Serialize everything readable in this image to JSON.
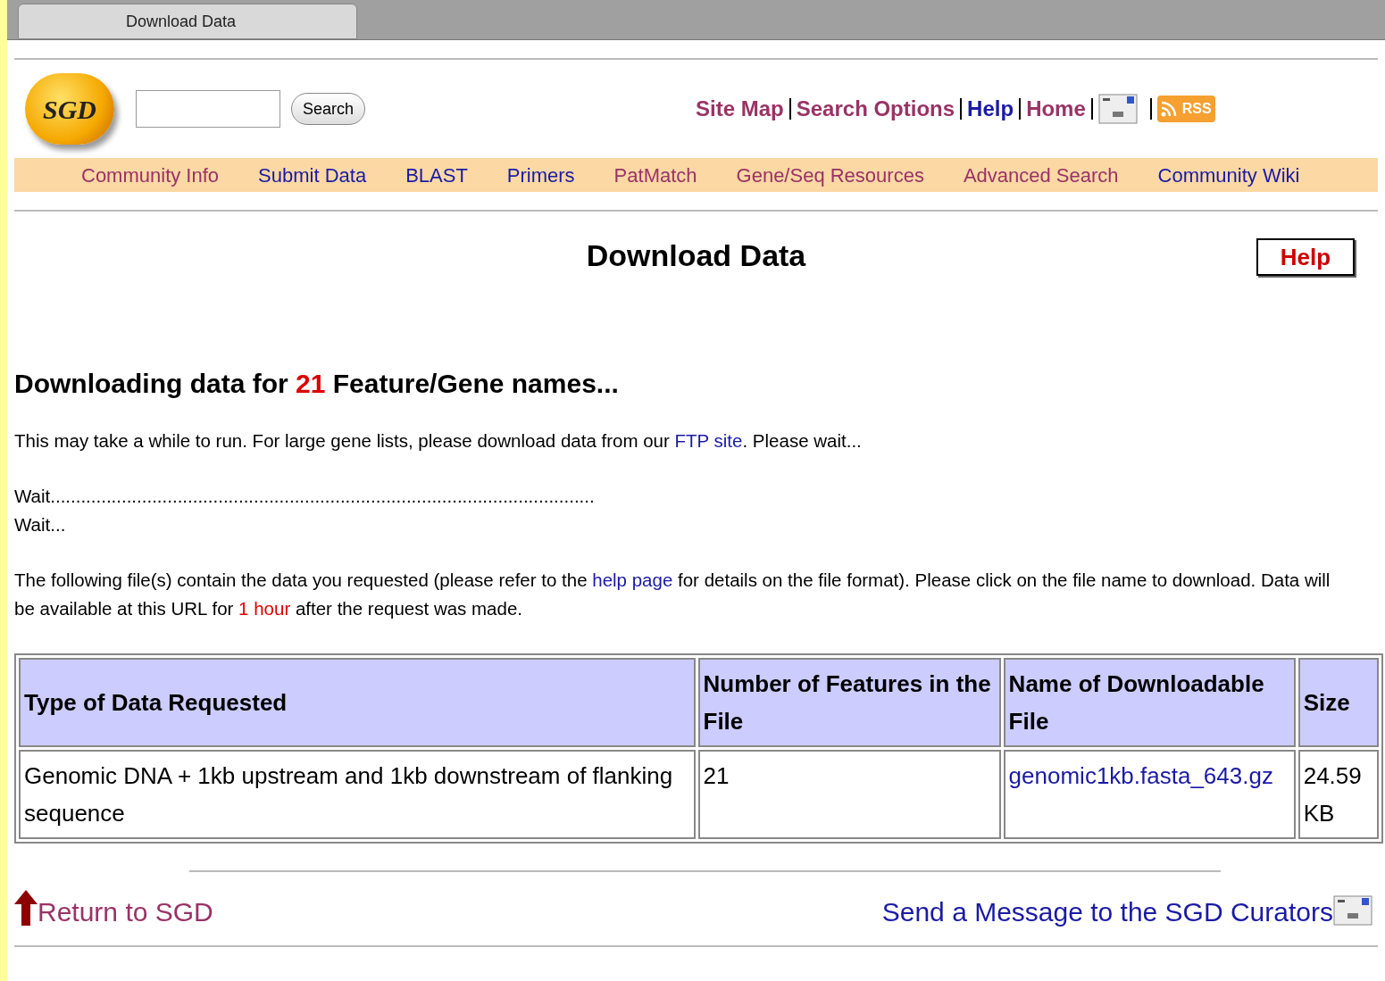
{
  "browser_tab": {
    "title": "Download Data"
  },
  "header": {
    "logo": "SGD",
    "search_button": "Search",
    "top_links": [
      {
        "label": "Site Map",
        "visited": true
      },
      {
        "label": "Search Options",
        "visited": true
      },
      {
        "label": "Help",
        "visited": false
      },
      {
        "label": "Home",
        "visited": true
      }
    ],
    "rss": "RSS"
  },
  "nav": [
    {
      "label": "Community Info",
      "visited": true
    },
    {
      "label": "Submit Data",
      "visited": false
    },
    {
      "label": "BLAST",
      "visited": false
    },
    {
      "label": "Primers",
      "visited": false
    },
    {
      "label": "PatMatch",
      "visited": true
    },
    {
      "label": "Gene/Seq Resources",
      "visited": true
    },
    {
      "label": "Advanced Search",
      "visited": true
    },
    {
      "label": "Community Wiki",
      "visited": false
    }
  ],
  "page_title": "Download Data",
  "help_button": "Help",
  "heading": [
    {
      "kind": "text",
      "text": "Downloading data for "
    },
    {
      "kind": "highlight",
      "text": "21"
    },
    {
      "kind": "text",
      "text": " Feature/Gene names..."
    }
  ],
  "paragraphs": [
    [
      {
        "kind": "text",
        "text": "This may take a while to run. For large gene lists, please download data from our "
      },
      {
        "kind": "link",
        "text": "FTP site",
        "visited": false
      },
      {
        "kind": "text",
        "text": ". Please wait..."
      }
    ],
    [
      {
        "kind": "text",
        "text": "Wait..........................................................................................................."
      }
    ],
    [
      {
        "kind": "text",
        "text": "Wait..."
      }
    ],
    [
      {
        "kind": "text",
        "text": "The following file(s) contain the data you requested (please refer to the "
      },
      {
        "kind": "link",
        "text": "help page",
        "visited": false
      },
      {
        "kind": "text",
        "text": " for details on the file format). Please click on the file name to download. Data will be available at this URL for "
      },
      {
        "kind": "highlight",
        "text": "1 hour"
      },
      {
        "kind": "text",
        "text": " after the request was made."
      }
    ]
  ],
  "table": {
    "columns": [
      "Type of Data Requested",
      "Number of Features in the File",
      "Name of Downloadable File",
      "Size"
    ],
    "rows": [
      {
        "type": "Genomic DNA + 1kb upstream and 1kb downstream of flanking sequence",
        "count": "21",
        "file": "genomic1kb.fasta_643.gz",
        "size": "24.59 KB"
      }
    ]
  },
  "footer": {
    "return_link": {
      "label": "Return to SGD",
      "visited": true
    },
    "message_link": {
      "label": "Send a Message to the SGD Curators",
      "visited": false
    }
  }
}
